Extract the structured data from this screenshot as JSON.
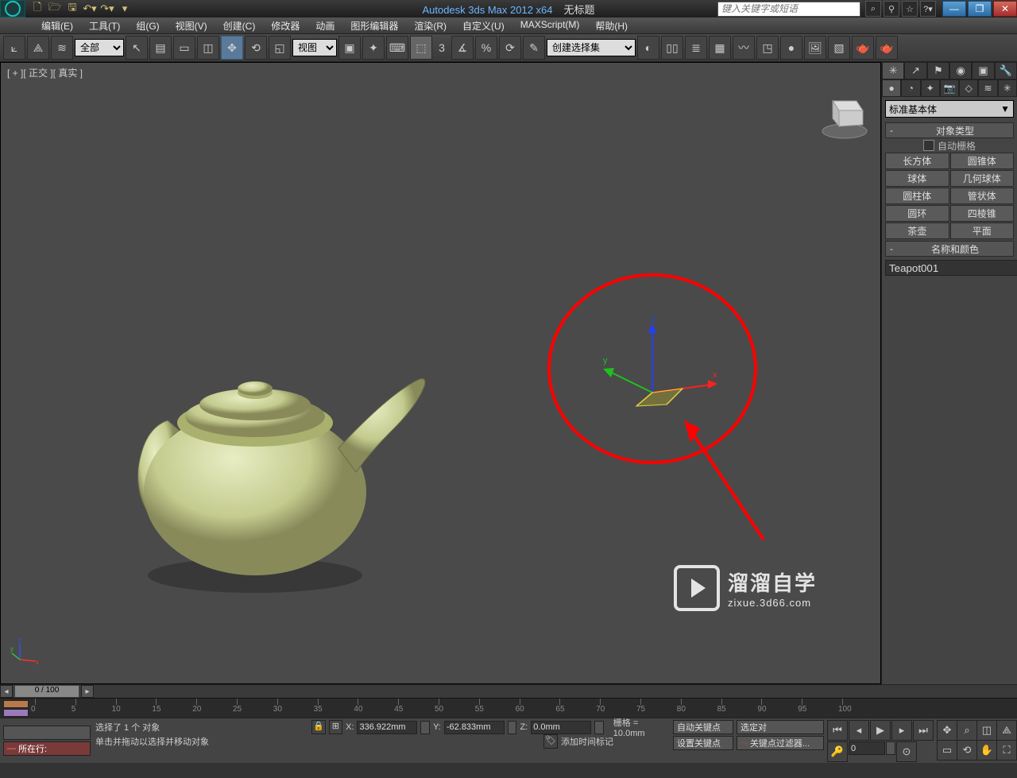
{
  "title": {
    "app": "Autodesk 3ds Max 2012 x64",
    "doc": "无标题"
  },
  "search": {
    "placeholder": "键入关键字或短语"
  },
  "menu": [
    "编辑(E)",
    "工具(T)",
    "组(G)",
    "视图(V)",
    "创建(C)",
    "修改器",
    "动画",
    "图形编辑器",
    "渲染(R)",
    "自定义(U)",
    "MAXScript(M)",
    "帮助(H)"
  ],
  "toolbar": {
    "filter": "全部",
    "viewsel": "视图",
    "named_sel": "创建选择集"
  },
  "viewport": {
    "label": "[ + ][ 正交 ][ 真实 ]",
    "axis": {
      "x": "x",
      "y": "y",
      "z": "z"
    }
  },
  "panel": {
    "dropdown": "标准基本体",
    "rollout_objtype": "对象类型",
    "autogrid": "自动栅格",
    "prims": [
      [
        "长方体",
        "圆锥体"
      ],
      [
        "球体",
        "几何球体"
      ],
      [
        "圆柱体",
        "管状体"
      ],
      [
        "圆环",
        "四棱锥"
      ],
      [
        "茶壶",
        "平面"
      ]
    ],
    "rollout_name": "名称和颜色",
    "obj_name": "Teapot001"
  },
  "timeline": {
    "label": "0 / 100",
    "ticks": [
      "0",
      "5",
      "10",
      "15",
      "20",
      "25",
      "30",
      "35",
      "40",
      "45",
      "50",
      "55",
      "60",
      "65",
      "70",
      "75",
      "80",
      "85",
      "90",
      "95",
      "100"
    ]
  },
  "status": {
    "lock": "所在行:",
    "sel_count": "选择了 1 个 对象",
    "hint": "单击并拖动以选择并移动对象",
    "x": "336.922mm",
    "y": "-62.833mm",
    "z": "0.0mm",
    "grid": "栅格 = 10.0mm",
    "add_time": "添加时间标记",
    "autokey": "自动关键点",
    "setkey": "设置关键点",
    "selobj": "选定对",
    "keyfilt": "关键点过滤器...",
    "frame": "0"
  },
  "watermark": {
    "l1": "溜溜自学",
    "l2": "zixue.3d66.com"
  }
}
